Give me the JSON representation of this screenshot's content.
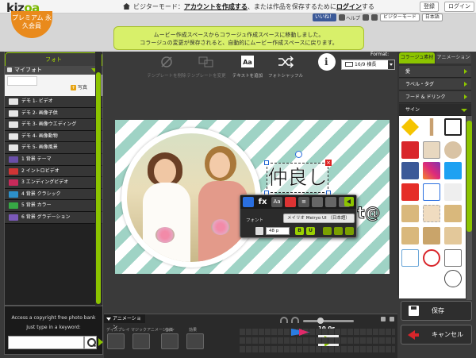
{
  "header": {
    "logo_text": "kizoa",
    "premium_label": "プレミアム 永久会員",
    "visitor_prefix": "ビジターモード：",
    "visitor_link1": "アカウントを作成する",
    "visitor_middle": "、または作品を保存するために",
    "visitor_link2": "ログイン",
    "visitor_suffix": "する",
    "register_button": "登録",
    "login_button": "ログイン",
    "fb_like": "いいね！",
    "help": "ヘルプ",
    "visitor_mode_select": "ビジターモード",
    "language_select": "日本語"
  },
  "notice": {
    "line1": "ムービー作成スペースからコラージュ作成スペースに移動しました。",
    "line2": "コラージュの変更が保存されると、自動的にムービー作成スペースに戻ります。"
  },
  "left_panel": {
    "tab_label": "フォト",
    "album_header": "マイフォト",
    "add_photo_label": "写真",
    "categories": [
      {
        "label": "デモ 1- ビデオ",
        "color": "#e6e6e6"
      },
      {
        "label": "デモ 2- 画像子供",
        "color": "#e6e6e6"
      },
      {
        "label": "デモ 3- 画像ウエディング",
        "color": "#e6e6e6"
      },
      {
        "label": "デモ 4- 画像動物",
        "color": "#e6e6e6"
      },
      {
        "label": "デモ 5- 画像風景",
        "color": "#e6e6e6"
      },
      {
        "label": "1 背景 テーマ",
        "color": "#6a4fa8"
      },
      {
        "label": "2 イントロビデオ",
        "color": "#d03535"
      },
      {
        "label": "3 エンディングビデオ",
        "color": "#c82a5a"
      },
      {
        "label": "4 背景 クラシック",
        "color": "#2d8fc8"
      },
      {
        "label": "5 背景 カラー",
        "color": "#37a845"
      },
      {
        "label": "6 背景 グラデーション",
        "color": "#7a59b8"
      }
    ],
    "keyword_line1": "Access a copyright free photo bank",
    "keyword_line2": "Just type in a keyword:",
    "keyword_value": ""
  },
  "toolbar": {
    "template_remove": "テンプレートを削除",
    "template_change": "テンプレートを変更",
    "add_text": "テキストを追加",
    "photo_shuffle": "フォトシャッフル",
    "format_label": "Format:",
    "format_value": "16/9 横長"
  },
  "canvas": {
    "text_box": "仲良し",
    "ghost_text": "t@"
  },
  "text_editor": {
    "fx_label": "fx",
    "font_label": "フォント",
    "font_value": "メイリオ Meiryo UI （日本語）",
    "size_value": "48 p",
    "bold_label": "B",
    "italic_label": "U"
  },
  "right_panel": {
    "tab_collage": "コラージュ素材",
    "tab_animation": "アニメーション",
    "items": [
      "愛",
      "ラベル・タグ",
      "フード & ドリンク",
      "サイン"
    ],
    "save_button": "保存",
    "cancel_button": "キャンセル"
  },
  "timeline": {
    "tab_label": "アニメーション",
    "label1": "ディスプレイ",
    "label2": "マジックアニメーション",
    "label3": "音楽",
    "label4": "効果",
    "time_value": "10.0s"
  }
}
